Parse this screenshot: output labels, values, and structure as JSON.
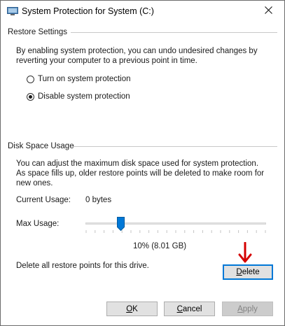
{
  "window": {
    "title": "System Protection for System (C:)",
    "icon": "system-properties-icon",
    "close_icon": "close-icon"
  },
  "restore_settings": {
    "header": "Restore Settings",
    "description": "By enabling system protection, you can undo undesired changes by reverting your computer to a previous point in time.",
    "options": [
      {
        "label": "Turn on system protection",
        "checked": false
      },
      {
        "label": "Disable system protection",
        "checked": true
      }
    ]
  },
  "disk_space": {
    "header": "Disk Space Usage",
    "description": "You can adjust the maximum disk space used for system protection. As space fills up, older restore points will be deleted to make room for new ones.",
    "current_usage_label": "Current Usage:",
    "current_usage_value": "0 bytes",
    "max_usage_label": "Max Usage:",
    "max_usage_fraction": 0.1,
    "max_usage_value": "10% (8.01 GB)",
    "delete_text": "Delete all restore points for this drive.",
    "delete_button": {
      "mnemonic": "D",
      "rest": "elete"
    }
  },
  "buttons": {
    "ok": {
      "mnemonic": "O",
      "rest": "K"
    },
    "cancel": {
      "mnemonic": "C",
      "rest": "ancel"
    },
    "apply": {
      "mnemonic": "A",
      "rest": "pply",
      "disabled": true
    }
  },
  "annotation": {
    "arrow_color": "#d40000",
    "arrow_icon": "red-down-arrow-icon"
  },
  "colors": {
    "accent": "#0078d7",
    "slider_thumb": "#0078d7"
  }
}
